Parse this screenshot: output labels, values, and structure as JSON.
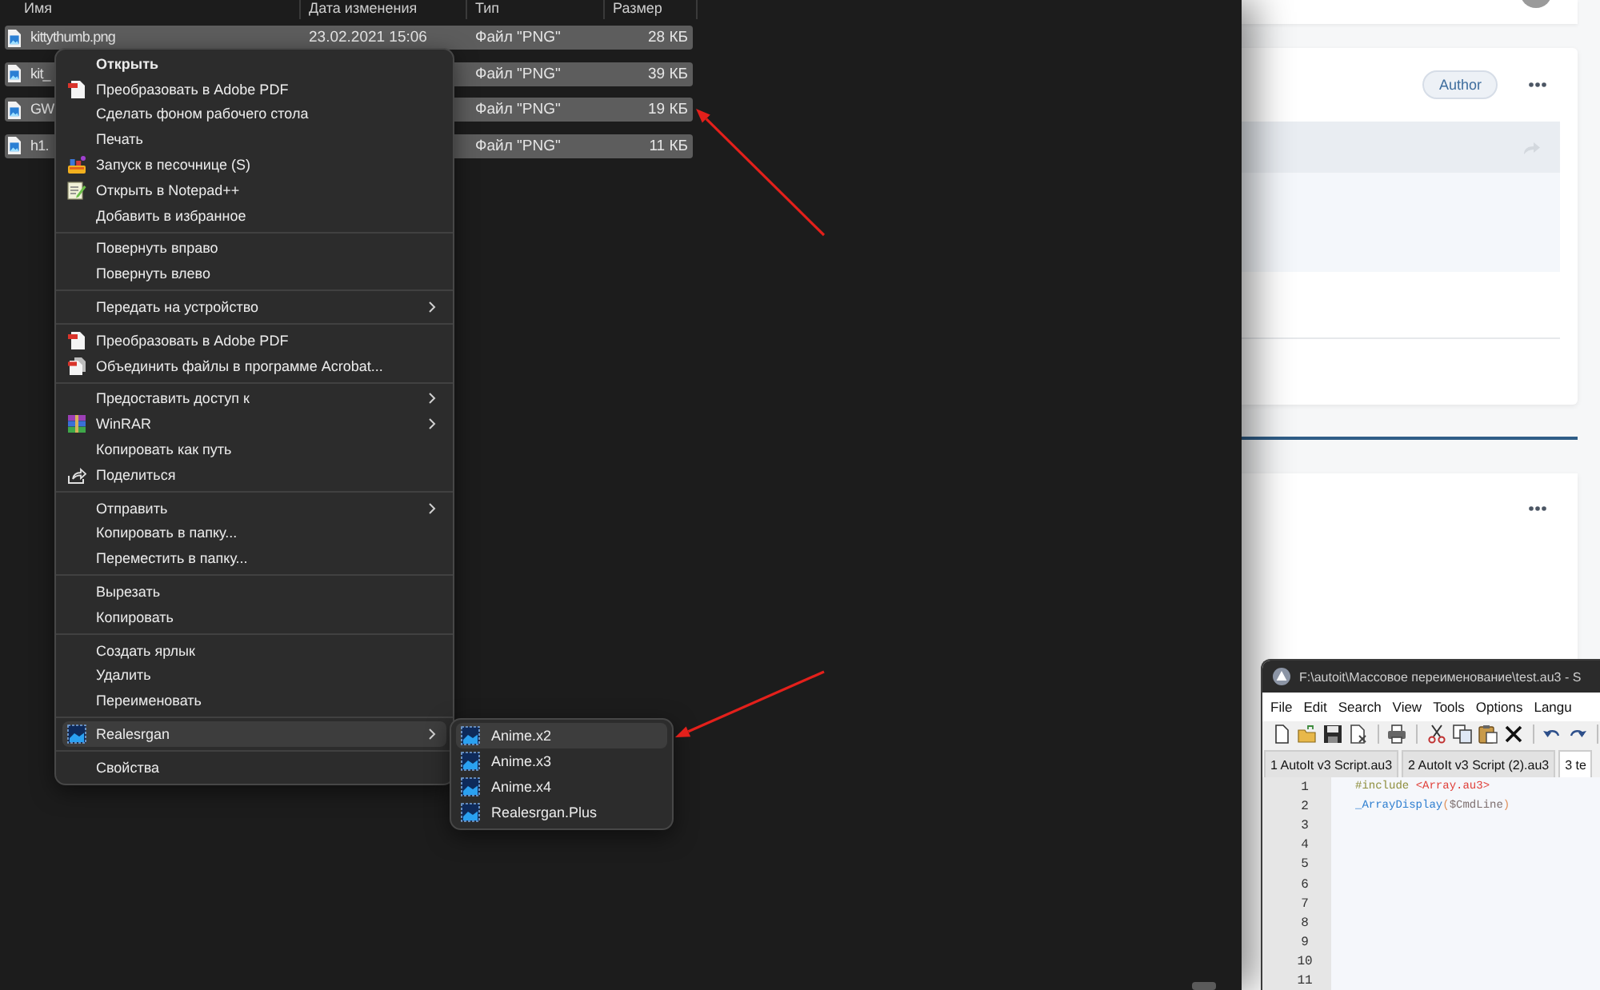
{
  "explorer": {
    "columns": [
      "Имя",
      "Дата изменения",
      "Тип",
      "Размер"
    ],
    "files": [
      {
        "name": "kittythumb.png",
        "modified": "23.02.2021 15:06",
        "type": "Файл \"PNG\"",
        "size": "28 КБ",
        "selected": true
      },
      {
        "name": "kit_",
        "type": "Файл \"PNG\"",
        "size": "39 КБ",
        "selected": true
      },
      {
        "name": "GW",
        "type": "Файл \"PNG\"",
        "size": "19 КБ",
        "selected": true
      },
      {
        "name": "h1.",
        "type": "Файл \"PNG\"",
        "size": "11 КБ",
        "selected": true
      }
    ]
  },
  "context_menu": {
    "groups": [
      {
        "items": [
          {
            "kind": "plain",
            "label": "Открыть",
            "default": true,
            "submenu": false,
            "selected": false
          },
          {
            "kind": "pdf",
            "label": "Преобразовать в Adobe PDF",
            "default": false,
            "submenu": false,
            "selected": false
          },
          {
            "kind": "plain",
            "label": "Сделать фоном рабочего стола",
            "default": false,
            "submenu": false,
            "selected": false
          },
          {
            "kind": "plain",
            "label": "Печать",
            "default": false,
            "submenu": false,
            "selected": false
          },
          {
            "kind": "sandbox",
            "label": "Запуск в песочнице (S)",
            "default": false,
            "submenu": false,
            "selected": false
          },
          {
            "kind": "notepad",
            "label": "Открыть в Notepad++",
            "default": false,
            "submenu": false,
            "selected": false
          },
          {
            "kind": "plain",
            "label": "Добавить в избранное",
            "default": false,
            "submenu": false,
            "selected": false
          }
        ]
      },
      {
        "items": [
          {
            "kind": "plain",
            "label": "Повернуть вправо",
            "default": false,
            "submenu": false,
            "selected": false
          },
          {
            "kind": "plain",
            "label": "Повернуть влево",
            "default": false,
            "submenu": false,
            "selected": false
          }
        ]
      },
      {
        "items": [
          {
            "kind": "plain",
            "label": "Передать на устройство",
            "default": false,
            "submenu": true,
            "selected": false
          }
        ]
      },
      {
        "items": [
          {
            "kind": "pdf",
            "label": "Преобразовать в Adobe PDF",
            "default": false,
            "submenu": false,
            "selected": false
          },
          {
            "kind": "acrobat",
            "label": "Объединить файлы в программе Acrobat...",
            "default": false,
            "submenu": false,
            "selected": false
          }
        ]
      },
      {
        "items": [
          {
            "kind": "plain",
            "label": "Предоставить доступ к",
            "default": false,
            "submenu": true,
            "selected": false
          },
          {
            "kind": "winrar",
            "label": "WinRAR",
            "default": false,
            "submenu": true,
            "selected": false
          },
          {
            "kind": "plain",
            "label": "Копировать как путь",
            "default": false,
            "submenu": false,
            "selected": false
          },
          {
            "kind": "share",
            "label": "Поделиться",
            "default": false,
            "submenu": false,
            "selected": false
          }
        ]
      },
      {
        "items": [
          {
            "kind": "plain",
            "label": "Отправить",
            "default": false,
            "submenu": true,
            "selected": false
          },
          {
            "kind": "plain",
            "label": "Копировать в папку...",
            "default": false,
            "submenu": false,
            "selected": false
          },
          {
            "kind": "plain",
            "label": "Переместить в папку...",
            "default": false,
            "submenu": false,
            "selected": false
          }
        ]
      },
      {
        "items": [
          {
            "kind": "plain",
            "label": "Вырезать",
            "default": false,
            "submenu": false,
            "selected": false
          },
          {
            "kind": "plain",
            "label": "Копировать",
            "default": false,
            "submenu": false,
            "selected": false
          }
        ]
      },
      {
        "items": [
          {
            "kind": "plain",
            "label": "Создать ярлык",
            "default": false,
            "submenu": false,
            "selected": false
          },
          {
            "kind": "plain",
            "label": "Удалить",
            "default": false,
            "submenu": false,
            "selected": false
          },
          {
            "kind": "plain",
            "label": "Переименовать",
            "default": false,
            "submenu": false,
            "selected": false
          }
        ]
      },
      {
        "items": [
          {
            "kind": "realesrgan",
            "label": "Realesrgan",
            "default": false,
            "submenu": true,
            "selected": true
          }
        ]
      },
      {
        "items": [
          {
            "kind": "plain",
            "label": "Свойства",
            "default": false,
            "submenu": false,
            "selected": false
          }
        ]
      }
    ]
  },
  "submenu": {
    "items": [
      {
        "label": "Anime.x2",
        "selected": true
      },
      {
        "label": "Anime.x3",
        "selected": false
      },
      {
        "label": "Anime.x4",
        "selected": false
      },
      {
        "label": "Realesrgan.Plus",
        "selected": false
      }
    ]
  },
  "web_page": {
    "badge": "Author"
  },
  "editor": {
    "title": "F:\\autoit\\Массовое переименование\\test.au3 - S",
    "menu": [
      "File",
      "Edit",
      "Search",
      "View",
      "Tools",
      "Options",
      "Langu"
    ],
    "tabs": [
      {
        "label": "1 AutoIt v3 Script.au3",
        "selected": false
      },
      {
        "label": "2 AutoIt v3 Script (2).au3",
        "selected": false
      },
      {
        "label": "3 te",
        "selected": true
      }
    ],
    "lines": [
      {
        "number": "1",
        "tokens": [
          {
            "kind": "directive",
            "text": "#include "
          },
          {
            "kind": "string",
            "text": "<Array.au3>"
          }
        ]
      },
      {
        "number": "2",
        "tokens": [
          {
            "kind": "function",
            "text": "_ArrayDisplay"
          },
          {
            "kind": "operator",
            "text": "("
          },
          {
            "kind": "variable",
            "text": "$CmdLine"
          },
          {
            "kind": "operator",
            "text": ")"
          }
        ]
      },
      {
        "number": "3"
      },
      {
        "number": "4"
      },
      {
        "number": "5"
      },
      {
        "number": "6"
      },
      {
        "number": "7"
      },
      {
        "number": "8"
      },
      {
        "number": "9"
      },
      {
        "number": "10"
      },
      {
        "number": "11"
      }
    ]
  }
}
